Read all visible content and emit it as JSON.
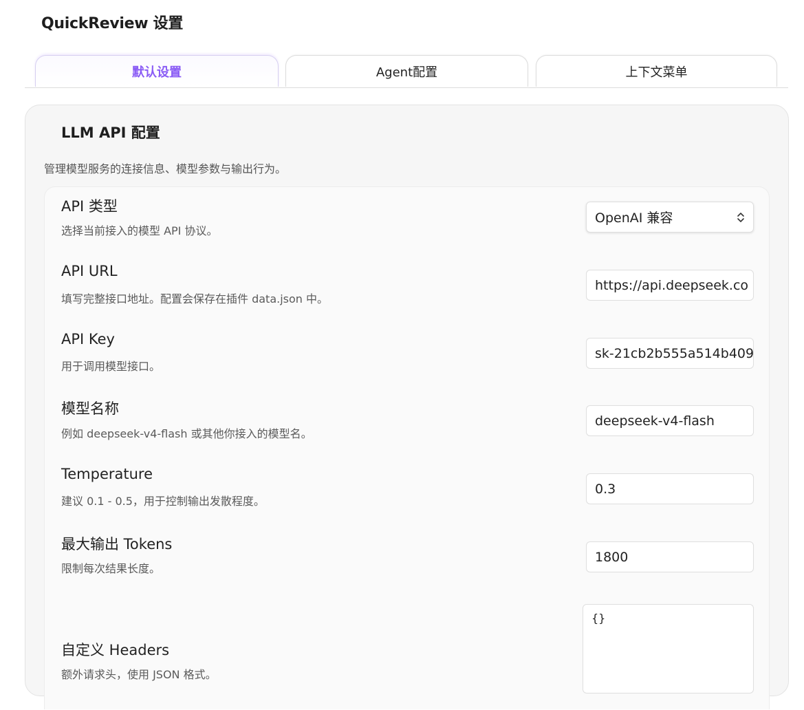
{
  "page_title": "QuickReview 设置",
  "tabs": [
    {
      "label": "默认设置",
      "active": true
    },
    {
      "label": "Agent配置",
      "active": false
    },
    {
      "label": "上下文菜单",
      "active": false
    }
  ],
  "section": {
    "title": "LLM API 配置",
    "description": "管理模型服务的连接信息、模型参数与输出行为。"
  },
  "settings": {
    "api_type": {
      "name": "API 类型",
      "help": "选择当前接入的模型 API 协议。",
      "value": "OpenAI 兼容",
      "icon": "chevron-up-down-icon"
    },
    "api_url": {
      "name": "API URL",
      "help": "填写完整接口地址。配置会保存在插件 data.json 中。",
      "value": "https://api.deepseek.co"
    },
    "api_key": {
      "name": "API Key",
      "help": "用于调用模型接口。",
      "value": "sk-21cb2b555a514b409"
    },
    "model_name": {
      "name": "模型名称",
      "help": "例如 deepseek-v4-flash 或其他你接入的模型名。",
      "value": "deepseek-v4-flash"
    },
    "temperature": {
      "name": "Temperature",
      "help": "建议 0.1 - 0.5，用于控制输出发散程度。",
      "value": "0.3"
    },
    "max_tokens": {
      "name": "最大输出 Tokens",
      "help": "限制每次结果长度。",
      "value": "1800"
    },
    "custom_headers": {
      "name": "自定义 Headers",
      "help": "额外请求头，使用 JSON 格式。",
      "value": "{}"
    }
  },
  "colors": {
    "accent": "#8a5cf5",
    "panel_bg": "#f6f6f6",
    "list_bg": "#fafafa"
  }
}
